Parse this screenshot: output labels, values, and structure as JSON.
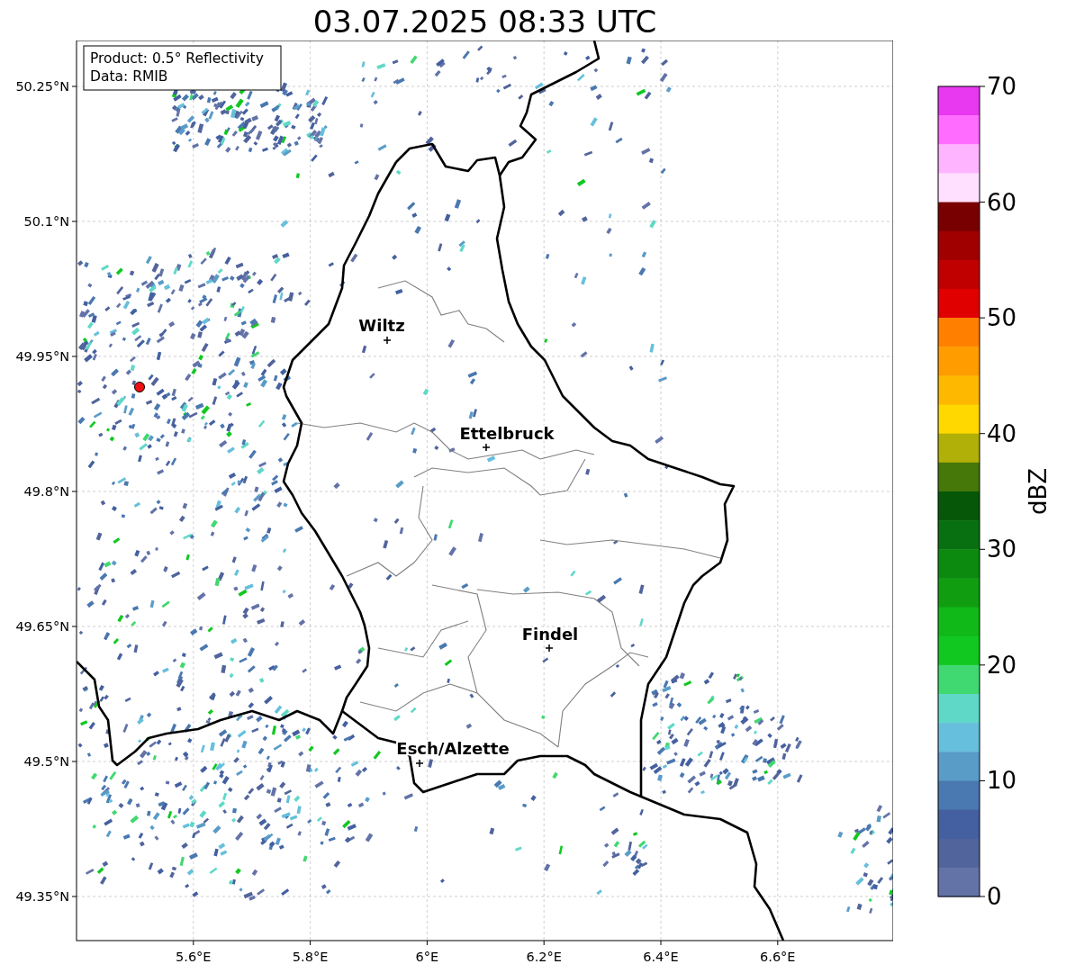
{
  "title": "03.07.2025 08:33 UTC",
  "info_box": {
    "lines": [
      "Product: 0.5° Reflectivity",
      "Data: RMIB"
    ]
  },
  "map": {
    "x_ticks": [
      "5.6°E",
      "5.8°E",
      "6°E",
      "6.2°E",
      "6.4°E",
      "6.6°E"
    ],
    "y_ticks": [
      "50.25°N",
      "50.1°N",
      "49.95°N",
      "49.8°N",
      "49.65°N",
      "49.5°N",
      "49.35°N"
    ],
    "places": [
      {
        "name": "Wiltz"
      },
      {
        "name": "Ettelbruck"
      },
      {
        "name": "Findel"
      },
      {
        "name": "Esch/Alzette"
      }
    ]
  },
  "colorbar": {
    "label": "dBZ",
    "ticks": [
      "70",
      "60",
      "50",
      "40",
      "30",
      "20",
      "10",
      "0"
    ],
    "segments": [
      {
        "color": "#e838f0"
      },
      {
        "color": "#ff6cff"
      },
      {
        "color": "#ffb4ff"
      },
      {
        "color": "#ffe0ff"
      },
      {
        "color": "#780000"
      },
      {
        "color": "#a00000"
      },
      {
        "color": "#c00000"
      },
      {
        "color": "#e00000"
      },
      {
        "color": "#ff8000"
      },
      {
        "color": "#ff9c00"
      },
      {
        "color": "#ffb800"
      },
      {
        "color": "#ffd800"
      },
      {
        "color": "#b0b008"
      },
      {
        "color": "#457808"
      },
      {
        "color": "#065808"
      },
      {
        "color": "#087010"
      },
      {
        "color": "#0c8a10"
      },
      {
        "color": "#109e10"
      },
      {
        "color": "#10b818"
      },
      {
        "color": "#10c820"
      },
      {
        "color": "#40d870"
      },
      {
        "color": "#60d8c8"
      },
      {
        "color": "#66bfdc"
      },
      {
        "color": "#5a9cc8"
      },
      {
        "color": "#4a78b0"
      },
      {
        "color": "#4460a0"
      },
      {
        "color": "#51649c"
      },
      {
        "color": "#6373a8"
      }
    ]
  }
}
